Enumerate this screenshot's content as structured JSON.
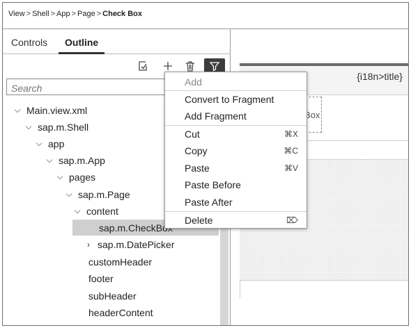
{
  "breadcrumb": {
    "items": [
      "View",
      "Shell",
      "App",
      "Page"
    ],
    "current": "Check Box",
    "separator": ">"
  },
  "tabs": [
    {
      "label": "Controls",
      "active": false
    },
    {
      "label": "Outline",
      "active": true
    }
  ],
  "toolbar": {
    "icons": [
      "collapse-all-icon",
      "add-icon",
      "delete-icon",
      "filter-icon"
    ]
  },
  "search": {
    "placeholder": "Search"
  },
  "tree": {
    "nodes": [
      {
        "label": "Main.view.xml",
        "chevron": "down"
      },
      {
        "label": "sap.m.Shell",
        "chevron": "down"
      },
      {
        "label": "app",
        "chevron": "down"
      },
      {
        "label": "sap.m.App",
        "chevron": "down"
      },
      {
        "label": "pages",
        "chevron": "down"
      },
      {
        "label": "sap.m.Page",
        "chevron": "down"
      },
      {
        "label": "content",
        "chevron": "down"
      },
      {
        "label": "sap.m.CheckBox",
        "chevron": "none",
        "selected": true
      },
      {
        "label": "sap.m.DatePicker",
        "chevron": "right"
      },
      {
        "label": "customHeader",
        "chevron": "none"
      },
      {
        "label": "footer",
        "chevron": "none"
      },
      {
        "label": "subHeader",
        "chevron": "none"
      },
      {
        "label": "headerContent",
        "chevron": "none"
      }
    ]
  },
  "canvas": {
    "title": "{i18n>title}",
    "placeholder_text": "Box"
  },
  "context_menu": {
    "items": [
      {
        "label": "Add",
        "shortcut": "",
        "disabled": true
      },
      {
        "label": "Convert to Fragment",
        "shortcut": ""
      },
      {
        "label": "Add Fragment",
        "shortcut": ""
      },
      {
        "label": "Cut",
        "shortcut": "⌘X"
      },
      {
        "label": "Copy",
        "shortcut": "⌘C"
      },
      {
        "label": "Paste",
        "shortcut": "⌘V"
      },
      {
        "label": "Paste Before",
        "shortcut": ""
      },
      {
        "label": "Paste After",
        "shortcut": ""
      },
      {
        "label": "Delete",
        "shortcut": "⌦"
      }
    ]
  },
  "colors": {
    "selected_row": "#cfcfcf",
    "filter_button": "#3c3c3c",
    "border": "#9a9a9a"
  }
}
